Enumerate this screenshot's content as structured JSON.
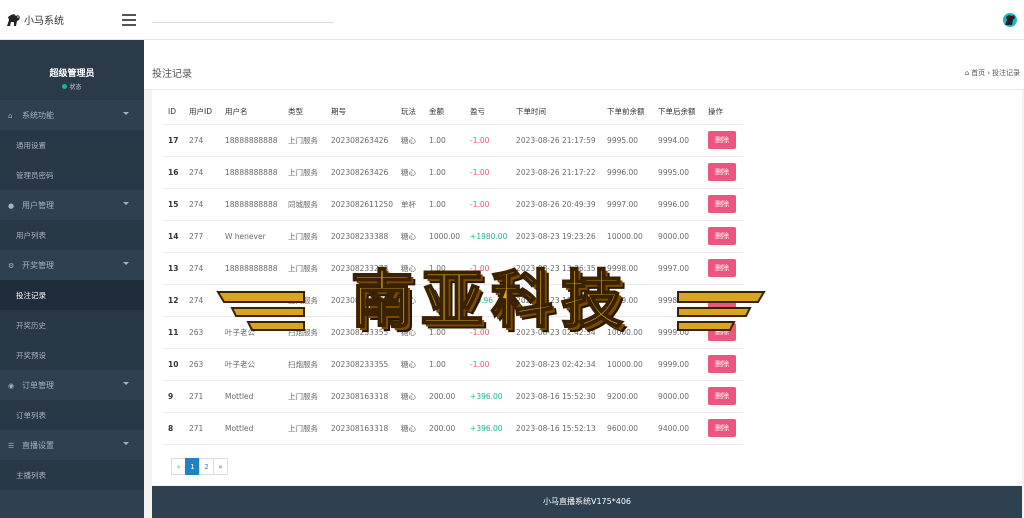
{
  "app": {
    "title": "小马系统",
    "footer": "小马直播系统V175*406"
  },
  "sidebar": {
    "profile_name": "超级管理员",
    "profile_status": "状态",
    "groups": [
      {
        "label": "系统功能",
        "icon": "home-icon",
        "items": [
          "通用设置",
          "管理员密码"
        ]
      },
      {
        "label": "用户管理",
        "icon": "user-icon",
        "items": [
          "用户列表"
        ]
      },
      {
        "label": "开奖管理",
        "icon": "gear-icon",
        "items": [
          "投注记录",
          "开奖历史",
          "开奖预设"
        ]
      },
      {
        "label": "订单管理",
        "icon": "cart-icon",
        "items": [
          "订单列表"
        ]
      },
      {
        "label": "直播设置",
        "icon": "list-icon",
        "items": [
          "主播列表"
        ]
      }
    ],
    "active_item": "投注记录"
  },
  "page": {
    "title": "投注记录",
    "breadcrumb_home": "首页",
    "breadcrumb_current": "投注记录"
  },
  "table": {
    "headers": [
      "ID",
      "用户ID",
      "用户名",
      "类型",
      "期号",
      "玩法",
      "金额",
      "盈亏",
      "下单时间",
      "下单前余额",
      "下单后余额",
      "操作"
    ],
    "delete_label": "删除",
    "rows": [
      [
        "17",
        "274",
        "18888888888",
        "上门服务",
        "202308263426",
        "糖心",
        "1.00",
        "-1.00",
        "2023-08-26 21:17:59",
        "9995.00",
        "9994.00"
      ],
      [
        "16",
        "274",
        "18888888888",
        "上门服务",
        "202308263426",
        "糖心",
        "1.00",
        "-1.00",
        "2023-08-26 21:17:22",
        "9996.00",
        "9995.00"
      ],
      [
        "15",
        "274",
        "18888888888",
        "同城服务",
        "202308261125​0",
        "单杯",
        "1.00",
        "-1.00",
        "2023-08-26 20:49:39",
        "9997.00",
        "9996.00"
      ],
      [
        "14",
        "277",
        "W henever",
        "上门服务",
        "202308233388",
        "糖心",
        "1000.00",
        "+1980.00",
        "2023-08-23 19:23:26",
        "10000.00",
        "9000.00"
      ],
      [
        "13",
        "274",
        "18888888888",
        "上门服务",
        "202308233273",
        "糖心",
        "1.00",
        "-1.00",
        "2023-08-23 13:36:35",
        "9998.00",
        "9997.00"
      ],
      [
        "12",
        "274",
        "18888888888",
        "上门服务",
        "202308233273",
        "糖心",
        "1.00",
        "+0.96",
        "2023-08-23 13:33:",
        "9999.00",
        "9998.00"
      ],
      [
        "11",
        "263",
        "叶子老公",
        "扫炮服务",
        "202308233355",
        "糖心",
        "1.00",
        "-1.00",
        "2023-08-23 02:42:34",
        "10000.00",
        "9999.00"
      ],
      [
        "10",
        "263",
        "叶子老公",
        "扫炮服务",
        "202308233355",
        "糖心",
        "1.00",
        "-1.00",
        "2023-08-23 02:42:34",
        "10000.00",
        "9999.00"
      ],
      [
        "9",
        "271",
        "Mottled",
        "上门服务",
        "202308163318",
        "糖心",
        "200.00",
        "+396.00",
        "2023-08-16 15:52:30",
        "9200.00",
        "9000.00"
      ],
      [
        "8",
        "271",
        "Mottled",
        "上门服务",
        "202308163318",
        "糖心",
        "200.00",
        "+396.00",
        "2023-08-16 15:52:13",
        "9600.00",
        "9400.00"
      ]
    ]
  },
  "pagination": {
    "prev": "«",
    "pages": [
      "1",
      "2"
    ],
    "next": "»",
    "current": "1"
  },
  "watermark": {
    "text": "南亚科技"
  },
  "colors": {
    "sidebar_bg": "#2f4050",
    "delete_button": "#ed5581",
    "loss": "#ed5565",
    "profit": "#1ab394",
    "page_active": "#1c84c6"
  }
}
